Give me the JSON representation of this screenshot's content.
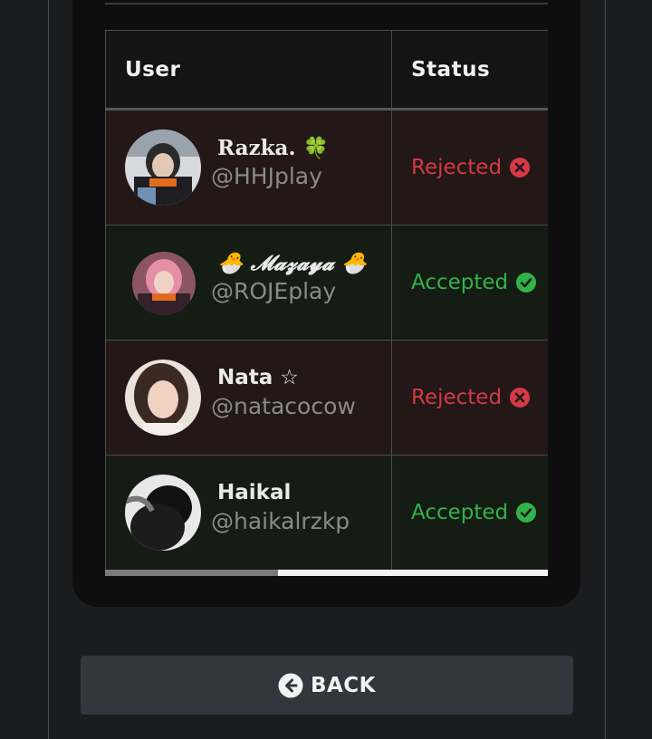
{
  "table": {
    "headers": {
      "user": "User",
      "status": "Status"
    },
    "rows": [
      {
        "name": "Razka. 🍀",
        "handle": "@HHJplay",
        "status": "Rejected",
        "status_type": "rejected"
      },
      {
        "name": "🐣 𝓜𝓪𝔃𝓪𝔂𝓪 🐣",
        "handle": "@ROJEplay",
        "status": "Accepted",
        "status_type": "accepted"
      },
      {
        "name": "Nata ☆",
        "handle": "@natacocow",
        "status": "Rejected",
        "status_type": "rejected"
      },
      {
        "name": "Haikal",
        "handle": "@haikalrzkp",
        "status": "Accepted",
        "status_type": "accepted"
      }
    ],
    "scroll_fraction": 0.39
  },
  "back_button": {
    "label": "BACK",
    "icon": "arrow-circle-left-icon"
  },
  "colors": {
    "rejected": "#d33a45",
    "accepted": "#33b249",
    "rejected_row_bg": "#231717",
    "accepted_row_bg": "#141c14"
  }
}
